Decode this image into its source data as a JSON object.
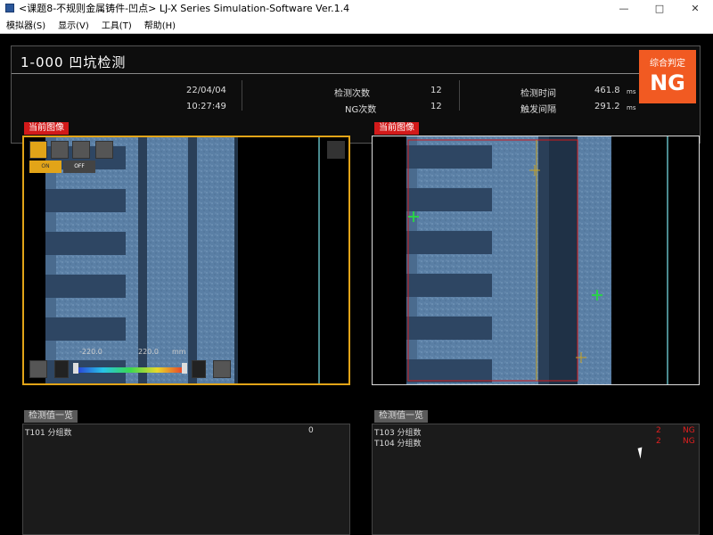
{
  "window": {
    "title": "<课题8-不规则金属铸件-凹点> LJ-X Series Simulation-Software Ver.1.4",
    "minimize": "—",
    "maximize": "□",
    "close": "✕"
  },
  "menu": [
    "模拟器(S)",
    "显示(V)",
    "工具(T)",
    "帮助(H)"
  ],
  "header": {
    "program": "1-000 凹坑检测",
    "date": "22/04/04",
    "time": "10:27:49",
    "count_label": "检测次数",
    "count_value": "12",
    "ng_label": "NG次数",
    "ng_value": "12",
    "time_label": "检测时间",
    "time_value": "461.8",
    "time_unit": "ms",
    "interval_label": "触发间隔",
    "interval_value": "291.2",
    "interval_unit": "ms",
    "result_label": "综合判定",
    "result_value": "NG"
  },
  "left_panel": {
    "tag": "当前图像",
    "scale_min": "-220.0",
    "scale_max": "220.0",
    "scale_unit": "mm",
    "on_label": "ON",
    "off_label": "OFF"
  },
  "right_panel": {
    "tag": "当前图像"
  },
  "left_list": {
    "tag": "检测值一览",
    "rows": [
      {
        "label": "T101 分组数",
        "value": "0",
        "status": ""
      }
    ]
  },
  "right_list": {
    "tag": "检测值一览",
    "rows": [
      {
        "label": "T103 分组数",
        "value": "2",
        "status": "NG"
      },
      {
        "label": "T104 分组数",
        "value": "2",
        "status": "NG"
      }
    ]
  },
  "icons": [
    "app-icon",
    "minimize-icon",
    "maximize-icon",
    "close-icon",
    "person-view-icon",
    "profile-icon",
    "ring-icon",
    "height-icon",
    "fullscreen-icon",
    "settings-gear-icon",
    "range-icon",
    "width-icon",
    "sort-icon"
  ],
  "colors": {
    "result_bg": "#f15a22",
    "tag_red": "#d21a1a",
    "selected_panel": "#e2a418"
  }
}
